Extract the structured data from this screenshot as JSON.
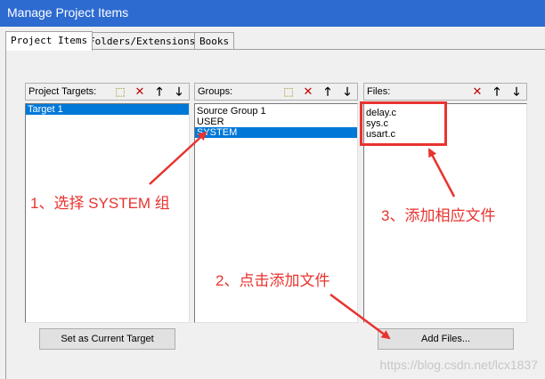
{
  "window": {
    "title": "Manage Project Items"
  },
  "tabs": [
    {
      "label": "Project Items",
      "active": true
    },
    {
      "label": "Folders/Extensions",
      "active": false
    },
    {
      "label": "Books",
      "active": false
    }
  ],
  "targets": {
    "header": "Project Targets:",
    "items": [
      {
        "label": "Target 1",
        "selected": true
      }
    ],
    "set_current_button": "Set as Current Target"
  },
  "groups": {
    "header": "Groups:",
    "items": [
      {
        "label": "Source Group 1",
        "selected": false
      },
      {
        "label": "USER",
        "selected": false
      },
      {
        "label": "SYSTEM",
        "selected": true
      }
    ]
  },
  "files": {
    "header": "Files:",
    "items": [
      {
        "label": "delay.c"
      },
      {
        "label": "sys.c"
      },
      {
        "label": "usart.c"
      }
    ],
    "add_button": "Add Files..."
  },
  "toolbar_icons": [
    "new-item-icon",
    "delete-icon",
    "move-up-icon",
    "move-down-icon"
  ],
  "annotations": {
    "step1": "1、选择 SYSTEM 组",
    "step2": "2、点击添加文件",
    "step3": "3、添加相应文件",
    "color": "#e8332f"
  },
  "watermark": "https://blog.csdn.net/lcx1837"
}
